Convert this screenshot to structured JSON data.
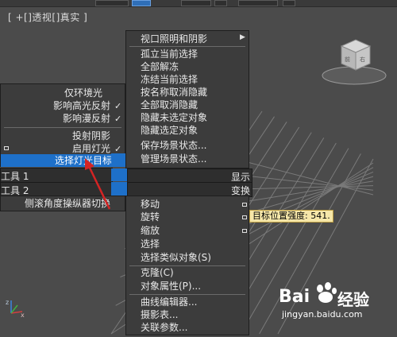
{
  "viewport": {
    "label": "[ +[]透视[]真实 ]"
  },
  "quad_right_top": [
    {
      "label": "视口照明和阴影",
      "submenu": true
    },
    {
      "label": "孤立当前选择"
    },
    {
      "label": "全部解冻"
    },
    {
      "label": "冻结当前选择"
    },
    {
      "label": "按名称取消隐藏"
    },
    {
      "label": "全部取消隐藏"
    },
    {
      "label": "隐藏未选定对象"
    },
    {
      "label": "隐藏选定对象"
    },
    {
      "label": "保存场景状态..."
    },
    {
      "label": "管理场景状态..."
    }
  ],
  "quad_left_top": [
    {
      "label": "仅环境光",
      "checked": false
    },
    {
      "label": "影响高光反射",
      "checked": true
    },
    {
      "label": "影响漫反射",
      "checked": true
    },
    {
      "label": "投射阴影",
      "checked": false
    },
    {
      "label": "启用灯光",
      "checked": true
    },
    {
      "label": "选择灯光目标",
      "checked": false,
      "highlighted": true
    }
  ],
  "quad_titles": {
    "tools1": "工具 1",
    "tools2": "工具 2",
    "display": "显示",
    "transform": "变换"
  },
  "quad_left_bottom": [
    {
      "label": "侧滚角度操纵器切换"
    }
  ],
  "quad_right_bottom": [
    {
      "label": "移动"
    },
    {
      "label": "旋转"
    },
    {
      "label": "缩放"
    },
    {
      "label": "选择"
    },
    {
      "label": "选择类似对象(S)"
    },
    {
      "label": "克隆(C)"
    },
    {
      "label": "对象属性(P)..."
    },
    {
      "label": "曲线编辑器..."
    },
    {
      "label": "摄影表..."
    },
    {
      "label": "关联参数..."
    }
  ],
  "tooltip": "目标位置强度: 541.",
  "watermark": {
    "logo": "Bai",
    "logo_suffix": "经验",
    "url": "jingyan.baidu.com"
  },
  "colors": {
    "highlight": "#1e70c9",
    "viewport_bg": "#4b4b4b",
    "menu_bg": "#3c3c3c",
    "arrow": "#d42424"
  }
}
